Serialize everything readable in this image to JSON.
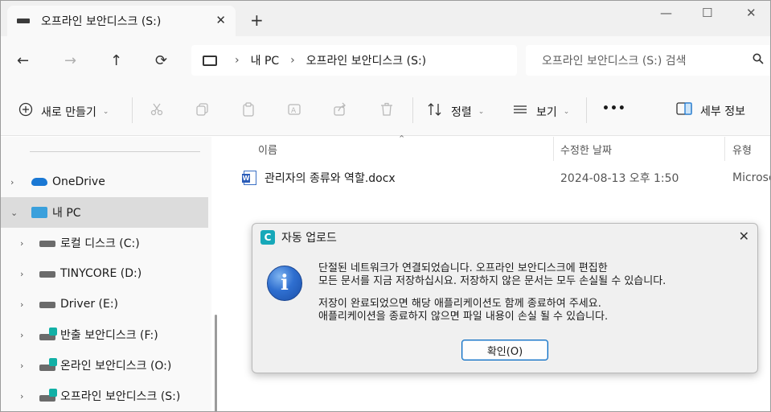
{
  "tab": {
    "title": "오프라인 보안디스크 (S:)",
    "close": "✕",
    "new_tab": "+"
  },
  "window_controls": {
    "minimize": "—",
    "maximize": "☐",
    "close": "✕"
  },
  "nav": {
    "back": "←",
    "forward": "→",
    "up": "↑",
    "refresh": "⟳"
  },
  "address": {
    "sep1": "›",
    "item1": "내 PC",
    "sep2": "›",
    "item2": "오프라인 보안디스크 (S:)"
  },
  "search": {
    "placeholder": "오프라인 보안디스크 (S:) 검색",
    "icon": "search-icon"
  },
  "toolbar": {
    "new_label": "새로 만들기",
    "sort_label": "정렬",
    "view_label": "보기",
    "more_label": "•••",
    "details_label": "세부 정보",
    "chevron": "⌄"
  },
  "sidebar": {
    "chevron_collapsed": "›",
    "chevron_expanded": "⌄",
    "items": [
      {
        "label": "OneDrive"
      },
      {
        "label": "내 PC"
      },
      {
        "label": "로컬 디스크 (C:)"
      },
      {
        "label": "TINYCORE (D:)"
      },
      {
        "label": "Driver (E:)"
      },
      {
        "label": "반출 보안디스크 (F:)"
      },
      {
        "label": "온라인 보안디스크 (O:)"
      },
      {
        "label": "오프라인 보안디스크 (S:)"
      }
    ]
  },
  "filelist": {
    "columns": {
      "name": "이름",
      "date": "수정한 날짜",
      "type": "유형"
    },
    "sort_indicator": "⌃",
    "rows": [
      {
        "name": "관리자의 종류와 역할.docx",
        "date": "2024-08-13 오후 1:50",
        "type": "Microso"
      }
    ]
  },
  "dialog": {
    "app_icon": "C",
    "title": "자동 업로드",
    "close": "✕",
    "info_glyph": "i",
    "line1": "단절된 네트워크가 연결되었습니다. 오프라인 보안디스크에 편집한",
    "line2": "모든 문서를 지금 저장하십시요. 저장하지 않은 문서는 모두 손실될 수 있습니다.",
    "line3": "저장이 완료되었으면 해당 애플리케이션도 함께 종료하여 주세요.",
    "line4": "애플리케이션을 종료하지 않으면 파일 내용이 손실 될 수 있습니다.",
    "ok_label": "확인(O)"
  }
}
